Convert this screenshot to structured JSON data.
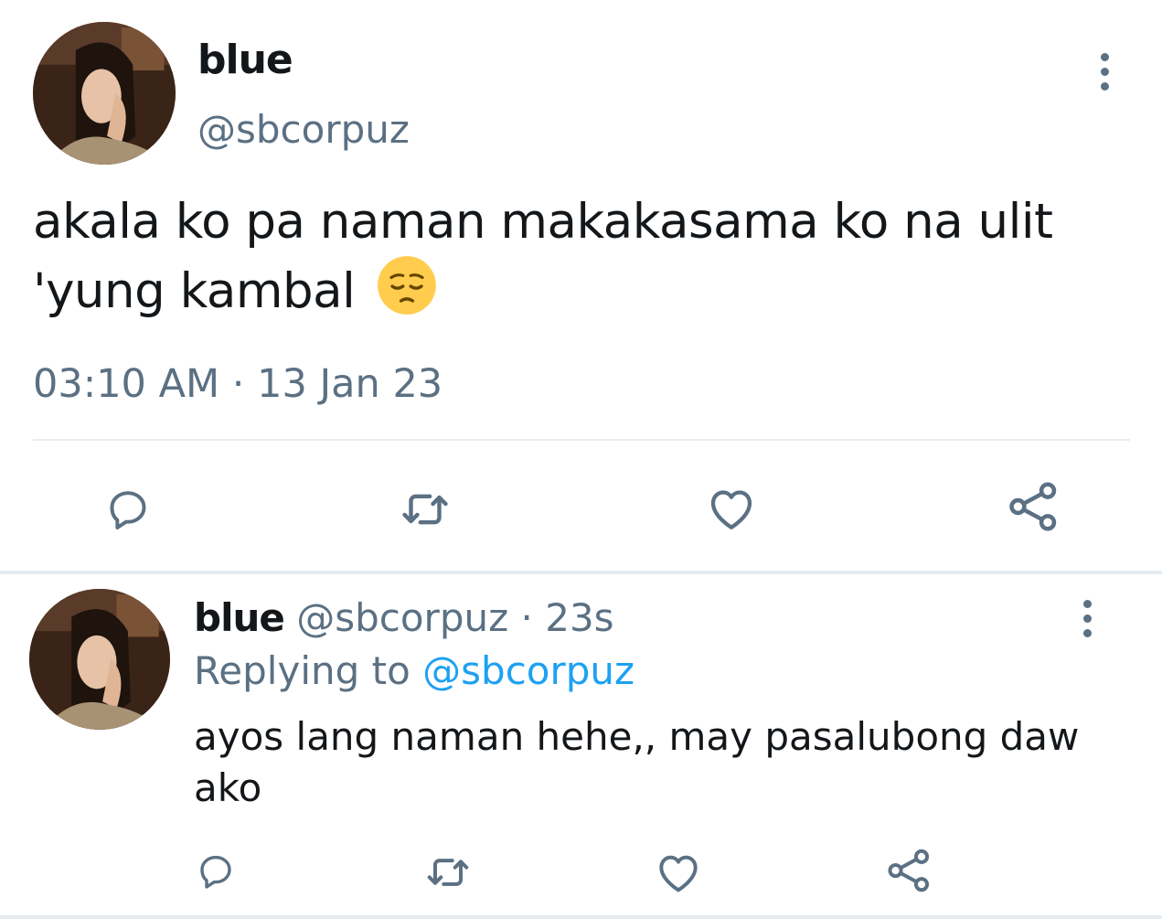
{
  "main_tweet": {
    "display_name": "blue",
    "handle": "@sbcorpuz",
    "text_line1": "akala ko pa naman makakasama ko na ulit",
    "text_line2": "'yung kambal",
    "emoji": "pensive-face",
    "timestamp": "03:10 AM · 13 Jan 23",
    "actions": [
      "reply-icon",
      "retweet-icon",
      "like-icon",
      "share-icon"
    ]
  },
  "reply_tweet": {
    "display_name": "blue",
    "handle": "@sbcorpuz",
    "dot": "·",
    "time": "23s",
    "replying_prefix": "Replying to",
    "replying_handle": "@sbcorpuz",
    "text": "ayos lang naman hehe,, may pasalubong daw ako",
    "actions": [
      "reply-icon",
      "retweet-icon",
      "like-icon",
      "share-icon"
    ]
  },
  "colors": {
    "text_primary": "#14171a",
    "text_secondary": "#5b7083",
    "link": "#1da1f2",
    "divider": "#e6ecf0",
    "emoji_face": "#ffcc4d"
  }
}
